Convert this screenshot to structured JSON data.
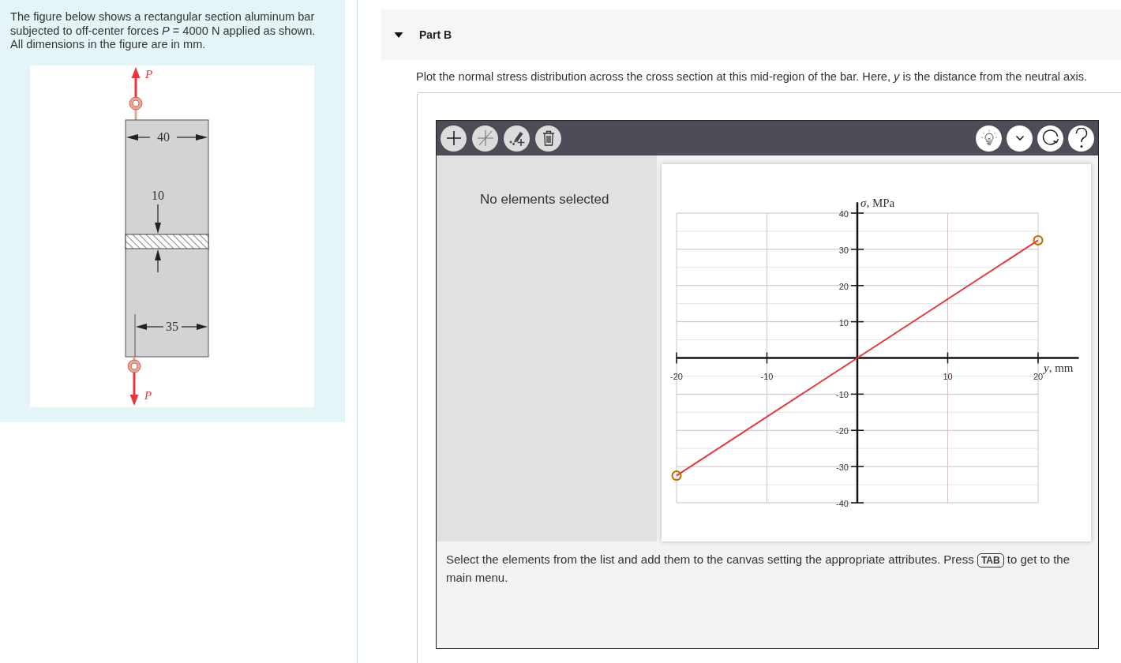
{
  "intro": {
    "text": "The figure below shows a rectangular section aluminum bar subjected to off-center forces *P* = 4000 N applied as shown. All dimensions in the figure are in mm."
  },
  "figure": {
    "top_force_label": "P",
    "width_dimension": "40",
    "section_dimension": "10",
    "offset_dimension": "35",
    "bottom_force_label": "P"
  },
  "part": {
    "title": "Part B",
    "expanded": true,
    "prompt": "Plot the normal stress distribution across the cross section at this mid-region of the bar. Here, *y* is the distance from the neutral axis."
  },
  "tool": {
    "status": "No elements selected",
    "chart_data": {
      "type": "line",
      "xlabel": "*y*, mm",
      "ylabel": "*σ*, MPa",
      "x": [
        -20,
        20
      ],
      "values": [
        -32.5,
        32.5
      ],
      "color": "#e0393e",
      "marker": "circle",
      "xlim": [
        -20,
        24.5
      ],
      "ylim": [
        -40,
        43
      ],
      "xticks": [
        -20,
        -10,
        10,
        20
      ],
      "yticks": [
        -40,
        -30,
        -20,
        -10,
        10,
        20,
        30,
        40
      ],
      "grid": true
    },
    "instruction": "Select the elements from the list and add them to the canvas setting the appropriate attributes. Press **TAB** to get to the main menu."
  }
}
